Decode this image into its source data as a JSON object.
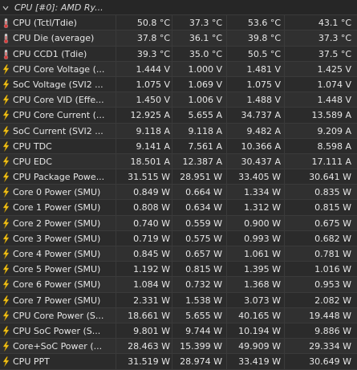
{
  "header": {
    "title": "CPU [#0]: AMD Ry..."
  },
  "rows": [
    {
      "label": "CPU (Tctl/Tdie)",
      "icon": "thermometer-icon",
      "v": [
        "50.8 °C",
        "37.3 °C",
        "53.6 °C",
        "43.1 °C"
      ]
    },
    {
      "label": "CPU Die (average)",
      "icon": "thermometer-icon",
      "v": [
        "37.8 °C",
        "36.1 °C",
        "39.8 °C",
        "37.3 °C"
      ]
    },
    {
      "label": "CPU CCD1 (Tdie)",
      "icon": "thermometer-icon",
      "v": [
        "39.3 °C",
        "35.0 °C",
        "50.5 °C",
        "37.5 °C"
      ]
    },
    {
      "label": "CPU Core Voltage (...",
      "icon": "lightning-icon",
      "v": [
        "1.444 V",
        "1.000 V",
        "1.481 V",
        "1.425 V"
      ]
    },
    {
      "label": "SoC Voltage (SVI2 ...",
      "icon": "lightning-icon",
      "v": [
        "1.075 V",
        "1.069 V",
        "1.075 V",
        "1.074 V"
      ]
    },
    {
      "label": "CPU Core VID (Effe...",
      "icon": "lightning-icon",
      "v": [
        "1.450 V",
        "1.006 V",
        "1.488 V",
        "1.448 V"
      ]
    },
    {
      "label": "CPU Core Current (...",
      "icon": "lightning-icon",
      "v": [
        "12.925 A",
        "5.655 A",
        "34.737 A",
        "13.589 A"
      ]
    },
    {
      "label": "SoC Current (SVI2 ...",
      "icon": "lightning-icon",
      "v": [
        "9.118 A",
        "9.118 A",
        "9.482 A",
        "9.209 A"
      ]
    },
    {
      "label": "CPU TDC",
      "icon": "lightning-icon",
      "v": [
        "9.141 A",
        "7.561 A",
        "10.366 A",
        "8.598 A"
      ]
    },
    {
      "label": "CPU EDC",
      "icon": "lightning-icon",
      "v": [
        "18.501 A",
        "12.387 A",
        "30.437 A",
        "17.111 A"
      ]
    },
    {
      "label": "CPU Package Powe...",
      "icon": "lightning-icon",
      "v": [
        "31.515 W",
        "28.951 W",
        "33.405 W",
        "30.641 W"
      ]
    },
    {
      "label": "Core 0 Power (SMU)",
      "icon": "lightning-icon",
      "v": [
        "0.849 W",
        "0.664 W",
        "1.334 W",
        "0.835 W"
      ]
    },
    {
      "label": "Core 1 Power (SMU)",
      "icon": "lightning-icon",
      "v": [
        "0.808 W",
        "0.634 W",
        "1.312 W",
        "0.815 W"
      ]
    },
    {
      "label": "Core 2 Power (SMU)",
      "icon": "lightning-icon",
      "v": [
        "0.740 W",
        "0.559 W",
        "0.900 W",
        "0.675 W"
      ]
    },
    {
      "label": "Core 3 Power (SMU)",
      "icon": "lightning-icon",
      "v": [
        "0.719 W",
        "0.575 W",
        "0.993 W",
        "0.682 W"
      ]
    },
    {
      "label": "Core 4 Power (SMU)",
      "icon": "lightning-icon",
      "v": [
        "0.845 W",
        "0.657 W",
        "1.061 W",
        "0.781 W"
      ]
    },
    {
      "label": "Core 5 Power (SMU)",
      "icon": "lightning-icon",
      "v": [
        "1.192 W",
        "0.815 W",
        "1.395 W",
        "1.016 W"
      ]
    },
    {
      "label": "Core 6 Power (SMU)",
      "icon": "lightning-icon",
      "v": [
        "1.084 W",
        "0.732 W",
        "1.368 W",
        "0.953 W"
      ]
    },
    {
      "label": "Core 7 Power (SMU)",
      "icon": "lightning-icon",
      "v": [
        "2.331 W",
        "1.538 W",
        "3.073 W",
        "2.082 W"
      ]
    },
    {
      "label": "CPU Core Power (S...",
      "icon": "lightning-icon",
      "v": [
        "18.661 W",
        "5.655 W",
        "40.165 W",
        "19.448 W"
      ]
    },
    {
      "label": "CPU SoC Power (S...",
      "icon": "lightning-icon",
      "v": [
        "9.801 W",
        "9.744 W",
        "10.194 W",
        "9.886 W"
      ]
    },
    {
      "label": "Core+SoC Power (...",
      "icon": "lightning-icon",
      "v": [
        "28.463 W",
        "15.399 W",
        "49.909 W",
        "29.334 W"
      ]
    },
    {
      "label": "CPU PPT",
      "icon": "lightning-icon",
      "v": [
        "31.519 W",
        "28.974 W",
        "33.419 W",
        "30.649 W"
      ]
    }
  ]
}
